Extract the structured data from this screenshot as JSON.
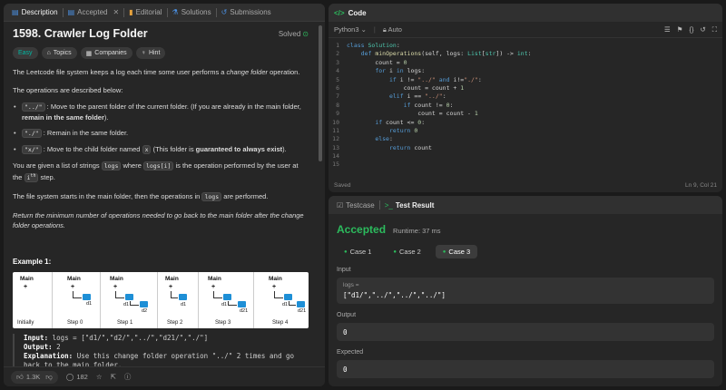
{
  "left_tabs": [
    {
      "label": "Description",
      "icon": "description-icon"
    },
    {
      "label": "Accepted",
      "icon": "accepted-icon"
    },
    {
      "label": "Editorial",
      "icon": "book-icon"
    },
    {
      "label": "Solutions",
      "icon": "flask-icon"
    },
    {
      "label": "Submissions",
      "icon": "history-icon"
    }
  ],
  "problem": {
    "title": "1598. Crawler Log Folder",
    "solved": "Solved",
    "chips": [
      "Easy",
      "Topics",
      "Companies",
      "Hint"
    ],
    "intro_a": "The Leetcode file system keeps a log each time some user performs a ",
    "intro_em": "change folder",
    "intro_b": " operation.",
    "ops_intro": "The operations are described below:",
    "op1_code": "\"../\"",
    "op1_a": " : Move to the parent folder of the current folder. (If you are already in the main folder, ",
    "op1_b": "remain in the same folder",
    "op1_c": ").",
    "op2_code": "\"./\"",
    "op2_a": " : Remain in the same folder.",
    "op3_code": "\"x/\"",
    "op3_a": " : Move to the child folder named ",
    "op3_x": "x",
    "op3_b": " (This folder is ",
    "op3_c": "guaranteed to always exist",
    "op3_d": ").",
    "given_a": "You are given a list of strings ",
    "given_logs": "logs",
    "given_b": " where ",
    "given_logsi": "logs[i]",
    "given_c": " is the operation performed by the user at the ",
    "given_i": "i",
    "given_th": "th",
    "given_d": " step.",
    "start_a": "The file system starts in the main folder, then the operations in ",
    "start_logs": "logs",
    "start_b": " are performed.",
    "ret": "Return the minimum number of operations needed to go back to the main folder after the change folder operations.",
    "example_title": "Example 1:"
  },
  "diagram": {
    "steps": [
      {
        "caption": "Initially"
      },
      {
        "caption": "Step 0"
      },
      {
        "caption": "Step 1"
      },
      {
        "caption": "Step 2"
      },
      {
        "caption": "Step 3"
      },
      {
        "caption": "Step 4"
      }
    ],
    "main": "Main",
    "plus": "+",
    "d1": "d1",
    "d2": "d2",
    "d21": "d21"
  },
  "example": {
    "input_label": "Input:",
    "input_value": " logs = [\"d1/\",\"d2/\",\"../\",\"d21/\",\"./\"]",
    "output_label": "Output:",
    "output_value": " 2",
    "expl_label": "Explanation:",
    "expl_value": " Use this change folder operation \"../\" 2 times and go back to the main folder."
  },
  "footer": {
    "likes": "1.3K",
    "comments": "182"
  },
  "code": {
    "title": "Code",
    "language": "Python3",
    "auto": "Auto",
    "saved": "Saved",
    "cursor": "Ln 9, Col 21"
  },
  "results": {
    "tab_testcase": "Testcase",
    "tab_result": "Test Result",
    "status": "Accepted",
    "runtime": "Runtime: 37 ms",
    "cases": [
      "Case 1",
      "Case 2",
      "Case 3"
    ],
    "input_label": "Input",
    "var_name": "logs =",
    "var_value": "[\"d1/\",\"../\",\"../\",\"../\"]",
    "output_label": "Output",
    "output_value": "0",
    "expected_label": "Expected",
    "expected_value": "0"
  }
}
